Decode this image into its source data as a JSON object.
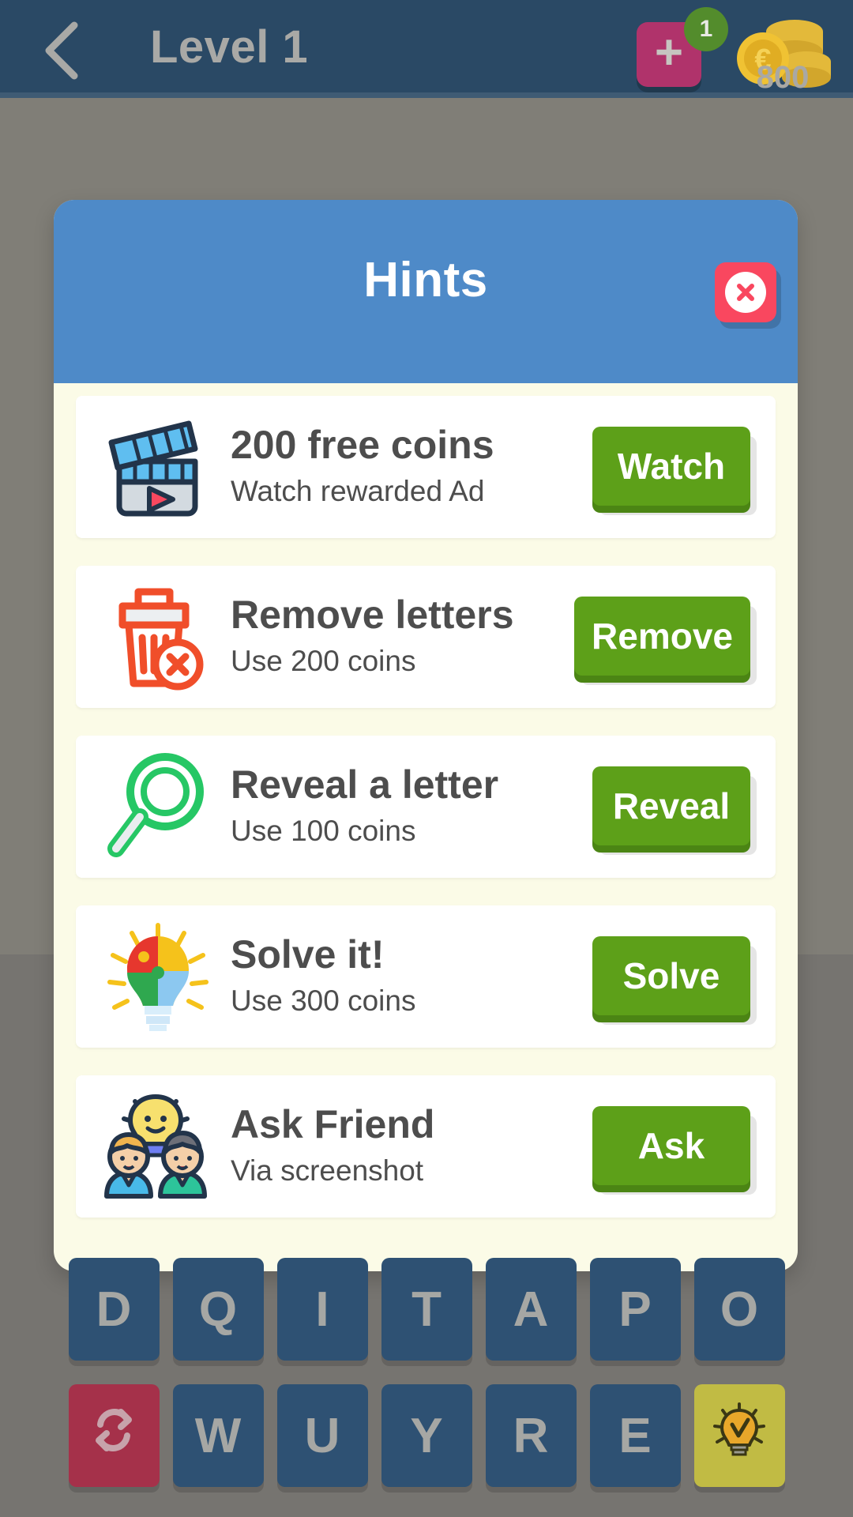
{
  "header": {
    "back_icon": "chevron-left-icon",
    "title": "Level 1",
    "add_button": {
      "icon": "plus-icon",
      "label": "+",
      "badge": "1"
    },
    "coins": {
      "icon": "coin-stack-icon",
      "amount": "800"
    }
  },
  "modal": {
    "title": "Hints",
    "close_icon": "close-x-icon",
    "accent_header": "#4e8ac8",
    "body_background": "#fbfbe7",
    "card_background": "#ffffff",
    "button_color": "#5da019",
    "close_color": "#f9475f",
    "hints": [
      {
        "icon": "clapperboard-video-icon",
        "title": "200 free coins",
        "subtitle": "Watch rewarded Ad",
        "action_label": "Watch"
      },
      {
        "icon": "trash-remove-icon",
        "title": "Remove letters",
        "subtitle": "Use 200 coins",
        "action_label": "Remove"
      },
      {
        "icon": "magnifier-reveal-icon",
        "title": "Reveal a letter",
        "subtitle": "Use 100 coins",
        "action_label": "Reveal"
      },
      {
        "icon": "puzzle-lightbulb-icon",
        "title": "Solve it!",
        "subtitle": "Use 300 coins",
        "action_label": "Solve"
      },
      {
        "icon": "friends-lightbulb-icon",
        "title": "Ask Friend",
        "subtitle": "Via screenshot",
        "action_label": "Ask"
      }
    ]
  },
  "keyboard": {
    "row1": [
      "D",
      "Q",
      "I",
      "T",
      "A",
      "P",
      "O"
    ],
    "row2_letters": [
      "W",
      "U",
      "Y",
      "R",
      "E"
    ],
    "shuffle_icon": "shuffle-refresh-icon",
    "hint_icon": "lightbulb-hint-icon"
  }
}
